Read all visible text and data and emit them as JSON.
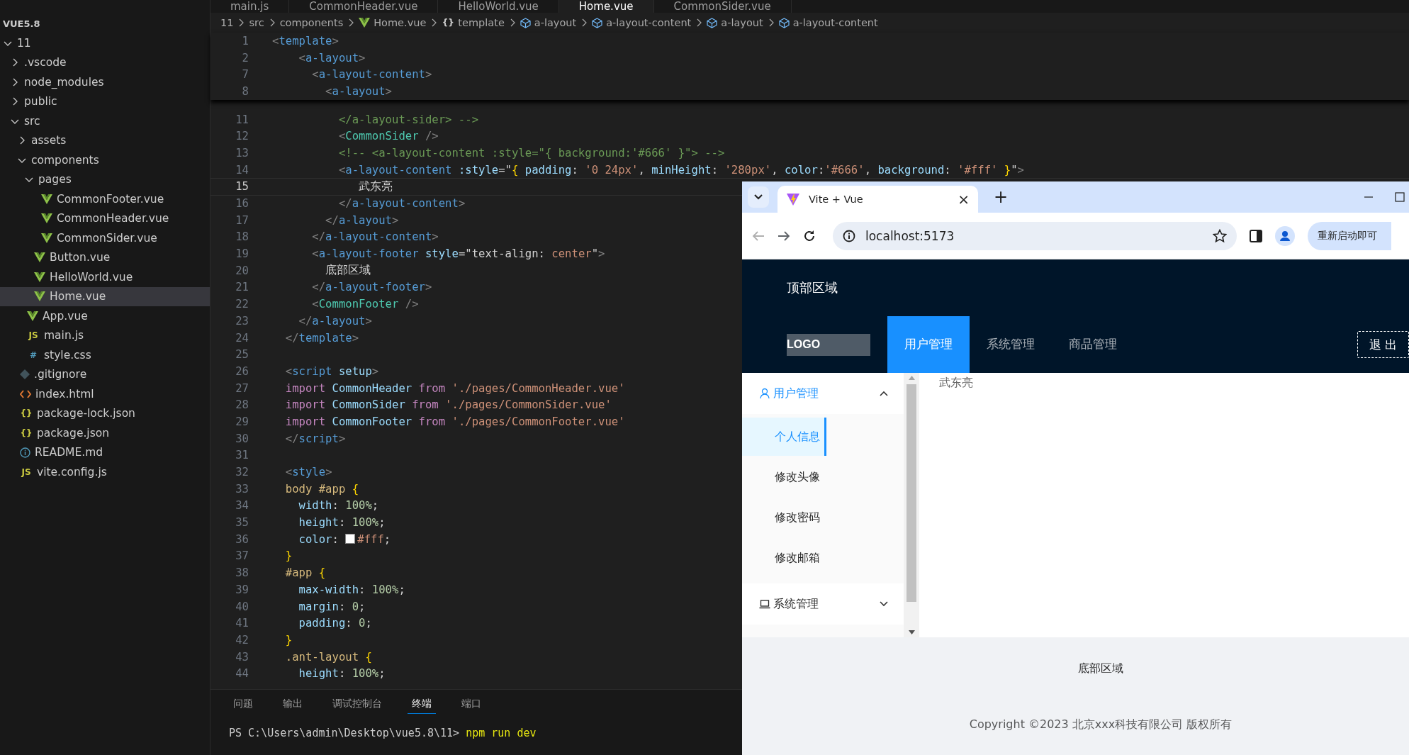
{
  "editor_tabs": [
    {
      "label": "main.js",
      "selected": false
    },
    {
      "label": "CommonHeader.vue",
      "selected": false
    },
    {
      "label": "HelloWorld.vue",
      "selected": false
    },
    {
      "label": "Home.vue",
      "selected": true
    },
    {
      "label": "CommonSider.vue",
      "selected": false
    }
  ],
  "explorer": {
    "workspace": "VUE5.8",
    "tree": [
      {
        "label": "11",
        "kind": "folder",
        "expanded": true,
        "selected": false,
        "children": [
          {
            "label": ".vscode",
            "kind": "folder",
            "expanded": false,
            "selected": false
          },
          {
            "label": "node_modules",
            "kind": "folder",
            "expanded": false,
            "selected": false
          },
          {
            "label": "public",
            "kind": "folder",
            "expanded": false,
            "selected": false
          },
          {
            "label": "src",
            "kind": "folder",
            "expanded": true,
            "selected": false,
            "children": [
              {
                "label": "assets",
                "kind": "folder",
                "expanded": false,
                "selected": false
              },
              {
                "label": "components",
                "kind": "folder",
                "expanded": true,
                "selected": false,
                "children": [
                  {
                    "label": "pages",
                    "kind": "folder",
                    "expanded": true,
                    "selected": false,
                    "children": [
                      {
                        "label": "CommonFooter.vue",
                        "kind": "vue",
                        "selected": false
                      },
                      {
                        "label": "CommonHeader.vue",
                        "kind": "vue",
                        "selected": false
                      },
                      {
                        "label": "CommonSider.vue",
                        "kind": "vue",
                        "selected": false
                      }
                    ]
                  },
                  {
                    "label": "Button.vue",
                    "kind": "vue",
                    "selected": false
                  },
                  {
                    "label": "HelloWorld.vue",
                    "kind": "vue",
                    "selected": false
                  },
                  {
                    "label": "Home.vue",
                    "kind": "vue",
                    "selected": true
                  }
                ]
              },
              {
                "label": "App.vue",
                "kind": "vue",
                "selected": false
              },
              {
                "label": "main.js",
                "kind": "js",
                "icon_text": "JS",
                "selected": false
              },
              {
                "label": "style.css",
                "kind": "css",
                "icon_text": "#",
                "selected": false
              }
            ]
          },
          {
            "label": ".gitignore",
            "kind": "git",
            "selected": false
          },
          {
            "label": "index.html",
            "kind": "html",
            "selected": false
          },
          {
            "label": "package-lock.json",
            "kind": "json",
            "icon_text": "{}",
            "selected": false
          },
          {
            "label": "package.json",
            "kind": "json",
            "icon_text": "{}",
            "selected": false
          },
          {
            "label": "README.md",
            "kind": "info",
            "selected": false
          },
          {
            "label": "vite.config.js",
            "kind": "js",
            "icon_text": "JS",
            "selected": false
          }
        ]
      }
    ]
  },
  "breadcrumb": [
    {
      "label": "11",
      "kind": "plain"
    },
    {
      "label": "src",
      "kind": "plain"
    },
    {
      "label": "components",
      "kind": "plain"
    },
    {
      "label": "Home.vue",
      "kind": "vue"
    },
    {
      "label": "template",
      "kind": "braces",
      "icon_text": "{}"
    },
    {
      "label": "a-layout",
      "kind": "element"
    },
    {
      "label": "a-layout-content",
      "kind": "element"
    },
    {
      "label": "a-layout",
      "kind": "element"
    },
    {
      "label": "a-layout-content",
      "kind": "element"
    }
  ],
  "sticky_lines": [
    {
      "number": "1",
      "tokens": [
        {
          "text": "<",
          "kind": "p"
        },
        {
          "text": "template",
          "kind": "t"
        },
        {
          "text": ">",
          "kind": "p"
        }
      ]
    },
    {
      "number": "2",
      "tokens": [
        {
          "text": "    <",
          "kind": "p"
        },
        {
          "text": "a-layout",
          "kind": "t"
        },
        {
          "text": ">",
          "kind": "p"
        }
      ]
    },
    {
      "number": "7",
      "tokens": [
        {
          "text": "      <",
          "kind": "p"
        },
        {
          "text": "a-layout-content",
          "kind": "t"
        },
        {
          "text": ">",
          "kind": "p"
        }
      ]
    },
    {
      "number": "8",
      "tokens": [
        {
          "text": "        <",
          "kind": "p"
        },
        {
          "text": "a-layout",
          "kind": "t"
        },
        {
          "text": ">",
          "kind": "p"
        }
      ]
    }
  ],
  "code_lines": [
    {
      "number": "11",
      "active": false,
      "tokens": [
        {
          "text": "          </a-layout-sider> -->",
          "kind": "m"
        }
      ]
    },
    {
      "number": "12",
      "active": false,
      "tokens": [
        {
          "text": "          <",
          "kind": "p"
        },
        {
          "text": "CommonSider",
          "kind": "c"
        },
        {
          "text": " />",
          "kind": "p"
        }
      ]
    },
    {
      "number": "13",
      "active": false,
      "tokens": [
        {
          "text": "          <!-- <a-layout-content :style=\"{ background:'#666' }\"> -->",
          "kind": "m"
        }
      ]
    },
    {
      "number": "14",
      "active": false,
      "tokens": [
        {
          "text": "          <",
          "kind": "p"
        },
        {
          "text": "a-layout-content",
          "kind": "t"
        },
        {
          "text": " :style",
          "kind": "a"
        },
        {
          "text": "=\"",
          "kind": "x"
        },
        {
          "text": "{",
          "kind": "b"
        },
        {
          "text": " padding",
          "kind": "a"
        },
        {
          "text": ": ",
          "kind": "x"
        },
        {
          "text": "'0 24px'",
          "kind": "s"
        },
        {
          "text": ", ",
          "kind": "x"
        },
        {
          "text": "minHeight",
          "kind": "a"
        },
        {
          "text": ": ",
          "kind": "x"
        },
        {
          "text": "'280px'",
          "kind": "s"
        },
        {
          "text": ", ",
          "kind": "x"
        },
        {
          "text": "color",
          "kind": "a"
        },
        {
          "text": ":",
          "kind": "x"
        },
        {
          "text": "'#666'",
          "kind": "s"
        },
        {
          "text": ", ",
          "kind": "x"
        },
        {
          "text": "background",
          "kind": "a"
        },
        {
          "text": ": ",
          "kind": "x"
        },
        {
          "text": "'#fff'",
          "kind": "s"
        },
        {
          "text": " }",
          "kind": "b"
        },
        {
          "text": "\"",
          "kind": "x"
        },
        {
          "text": ">",
          "kind": "p"
        }
      ]
    },
    {
      "number": "15",
      "active": true,
      "tokens": [
        {
          "text": "             武东亮",
          "kind": "x"
        }
      ]
    },
    {
      "number": "16",
      "active": false,
      "tokens": [
        {
          "text": "          </",
          "kind": "p"
        },
        {
          "text": "a-layout-content",
          "kind": "t"
        },
        {
          "text": ">",
          "kind": "p"
        }
      ]
    },
    {
      "number": "17",
      "active": false,
      "tokens": [
        {
          "text": "        </",
          "kind": "p"
        },
        {
          "text": "a-layout",
          "kind": "t"
        },
        {
          "text": ">",
          "kind": "p"
        }
      ]
    },
    {
      "number": "18",
      "active": false,
      "tokens": [
        {
          "text": "      </",
          "kind": "p"
        },
        {
          "text": "a-layout-content",
          "kind": "t"
        },
        {
          "text": ">",
          "kind": "p"
        }
      ]
    },
    {
      "number": "19",
      "active": false,
      "tokens": [
        {
          "text": "      <",
          "kind": "p"
        },
        {
          "text": "a-layout-footer",
          "kind": "t"
        },
        {
          "text": " style",
          "kind": "a"
        },
        {
          "text": "=\"",
          "kind": "x"
        },
        {
          "text": "text-align",
          "kind": "x"
        },
        {
          "text": ": ",
          "kind": "x"
        },
        {
          "text": "center",
          "kind": "s"
        },
        {
          "text": "\"",
          "kind": "x"
        },
        {
          "text": ">",
          "kind": "p"
        }
      ]
    },
    {
      "number": "20",
      "active": false,
      "tokens": [
        {
          "text": "        底部区域",
          "kind": "x"
        }
      ]
    },
    {
      "number": "21",
      "active": false,
      "tokens": [
        {
          "text": "      </",
          "kind": "p"
        },
        {
          "text": "a-layout-footer",
          "kind": "t"
        },
        {
          "text": ">",
          "kind": "p"
        }
      ]
    },
    {
      "number": "22",
      "active": false,
      "tokens": [
        {
          "text": "      <",
          "kind": "p"
        },
        {
          "text": "CommonFooter",
          "kind": "c"
        },
        {
          "text": " />",
          "kind": "p"
        }
      ]
    },
    {
      "number": "23",
      "active": false,
      "tokens": [
        {
          "text": "    </",
          "kind": "p"
        },
        {
          "text": "a-layout",
          "kind": "t"
        },
        {
          "text": ">",
          "kind": "p"
        }
      ]
    },
    {
      "number": "24",
      "active": false,
      "tokens": [
        {
          "text": "  </",
          "kind": "p"
        },
        {
          "text": "template",
          "kind": "t"
        },
        {
          "text": ">",
          "kind": "p"
        }
      ]
    },
    {
      "number": "25",
      "active": false
    },
    {
      "number": "26",
      "active": false,
      "tokens": [
        {
          "text": "  <",
          "kind": "p"
        },
        {
          "text": "script",
          "kind": "t"
        },
        {
          "text": " setup",
          "kind": "a"
        },
        {
          "text": ">",
          "kind": "p"
        }
      ]
    },
    {
      "number": "27",
      "active": false,
      "tokens": [
        {
          "text": "  import",
          "kind": "k"
        },
        {
          "text": " CommonHeader ",
          "kind": "a"
        },
        {
          "text": "from",
          "kind": "k"
        },
        {
          "text": " './pages/CommonHeader.vue'",
          "kind": "s"
        }
      ]
    },
    {
      "number": "28",
      "active": false,
      "tokens": [
        {
          "text": "  import",
          "kind": "k"
        },
        {
          "text": " CommonSider ",
          "kind": "a"
        },
        {
          "text": "from",
          "kind": "k"
        },
        {
          "text": " './pages/CommonSider.vue'",
          "kind": "s"
        }
      ]
    },
    {
      "number": "29",
      "active": false,
      "tokens": [
        {
          "text": "  import",
          "kind": "k"
        },
        {
          "text": " CommonFooter ",
          "kind": "a"
        },
        {
          "text": "from",
          "kind": "k"
        },
        {
          "text": " './pages/CommonFooter.vue'",
          "kind": "s"
        }
      ]
    },
    {
      "number": "30",
      "active": false,
      "tokens": [
        {
          "text": "  </",
          "kind": "p"
        },
        {
          "text": "script",
          "kind": "t"
        },
        {
          "text": ">",
          "kind": "p"
        }
      ]
    },
    {
      "number": "31",
      "active": false
    },
    {
      "number": "32",
      "active": false,
      "tokens": [
        {
          "text": "  <",
          "kind": "p"
        },
        {
          "text": "style",
          "kind": "t"
        },
        {
          "text": ">",
          "kind": "p"
        }
      ]
    },
    {
      "number": "33",
      "active": false,
      "tokens": [
        {
          "text": "  body #app ",
          "kind": "e"
        },
        {
          "text": "{",
          "kind": "b"
        }
      ]
    },
    {
      "number": "34",
      "active": false,
      "tokens": [
        {
          "text": "    width",
          "kind": "a"
        },
        {
          "text": ": ",
          "kind": "x"
        },
        {
          "text": "100%",
          "kind": "n"
        },
        {
          "text": ";",
          "kind": "x"
        }
      ]
    },
    {
      "number": "35",
      "active": false,
      "tokens": [
        {
          "text": "    height",
          "kind": "a"
        },
        {
          "text": ": ",
          "kind": "x"
        },
        {
          "text": "100%",
          "kind": "n"
        },
        {
          "text": ";",
          "kind": "x"
        }
      ]
    },
    {
      "number": "36",
      "active": false,
      "tokens": [
        {
          "text": "    color",
          "kind": "a"
        },
        {
          "text": ": ",
          "kind": "x"
        },
        {
          "text": "#fff",
          "kind": "s",
          "swatch": true
        },
        {
          "text": ";",
          "kind": "x"
        }
      ]
    },
    {
      "number": "37",
      "active": false,
      "tokens": [
        {
          "text": "  }",
          "kind": "b"
        }
      ]
    },
    {
      "number": "38",
      "active": false,
      "tokens": [
        {
          "text": "  #app ",
          "kind": "e"
        },
        {
          "text": "{",
          "kind": "b"
        }
      ]
    },
    {
      "number": "39",
      "active": false,
      "tokens": [
        {
          "text": "    max-width",
          "kind": "a"
        },
        {
          "text": ": ",
          "kind": "x"
        },
        {
          "text": "100%",
          "kind": "n"
        },
        {
          "text": ";",
          "kind": "x"
        }
      ]
    },
    {
      "number": "40",
      "active": false,
      "tokens": [
        {
          "text": "    margin",
          "kind": "a"
        },
        {
          "text": ": ",
          "kind": "x"
        },
        {
          "text": "0",
          "kind": "n"
        },
        {
          "text": ";",
          "kind": "x"
        }
      ]
    },
    {
      "number": "41",
      "active": false,
      "tokens": [
        {
          "text": "    padding",
          "kind": "a"
        },
        {
          "text": ": ",
          "kind": "x"
        },
        {
          "text": "0",
          "kind": "n"
        },
        {
          "text": ";",
          "kind": "x"
        }
      ]
    },
    {
      "number": "42",
      "active": false,
      "tokens": [
        {
          "text": "  }",
          "kind": "b"
        }
      ]
    },
    {
      "number": "43",
      "active": false,
      "tokens": [
        {
          "text": "  .ant-layout ",
          "kind": "e"
        },
        {
          "text": "{",
          "kind": "b"
        }
      ]
    },
    {
      "number": "44",
      "active": false,
      "tokens": [
        {
          "text": "    height",
          "kind": "a"
        },
        {
          "text": ": ",
          "kind": "x"
        },
        {
          "text": "100%",
          "kind": "n"
        },
        {
          "text": ";",
          "kind": "x"
        }
      ]
    }
  ],
  "panel": {
    "tabs": [
      {
        "label": "问题",
        "selected": false
      },
      {
        "label": "输出",
        "selected": false
      },
      {
        "label": "调试控制台",
        "selected": false
      },
      {
        "label": "终端",
        "selected": true
      },
      {
        "label": "端口",
        "selected": false
      }
    ],
    "terminal": {
      "prompt": "PS C:\\Users\\admin\\Desktop\\vue5.8\\11>",
      "command": "npm run dev"
    }
  },
  "browser": {
    "tab": {
      "title": "Vite + Vue",
      "close": "×"
    },
    "new_tab": "+",
    "url": "localhost:5173",
    "update_pill": "重新启动即可",
    "page": {
      "header_title": "顶部区域",
      "logo": "LOGO",
      "menu": [
        {
          "label": "用户管理",
          "selected": true
        },
        {
          "label": "系统管理",
          "selected": false
        },
        {
          "label": "商品管理",
          "selected": false
        }
      ],
      "logout": "退 出",
      "sider": [
        {
          "label": "用户管理",
          "kind": "user",
          "expanded": true,
          "selected": true,
          "children": [
            {
              "label": "个人信息",
              "selected": true
            },
            {
              "label": "修改头像",
              "selected": false
            },
            {
              "label": "修改密码",
              "selected": false
            },
            {
              "label": "修改邮箱",
              "selected": false
            }
          ]
        },
        {
          "label": "系统管理",
          "kind": "laptop",
          "expanded": false,
          "selected": false
        }
      ],
      "content": "武东亮",
      "footer_title": "底部区域",
      "copyright": "Copyright ©2023 北京xxx科技有限公司 版权所有"
    }
  }
}
